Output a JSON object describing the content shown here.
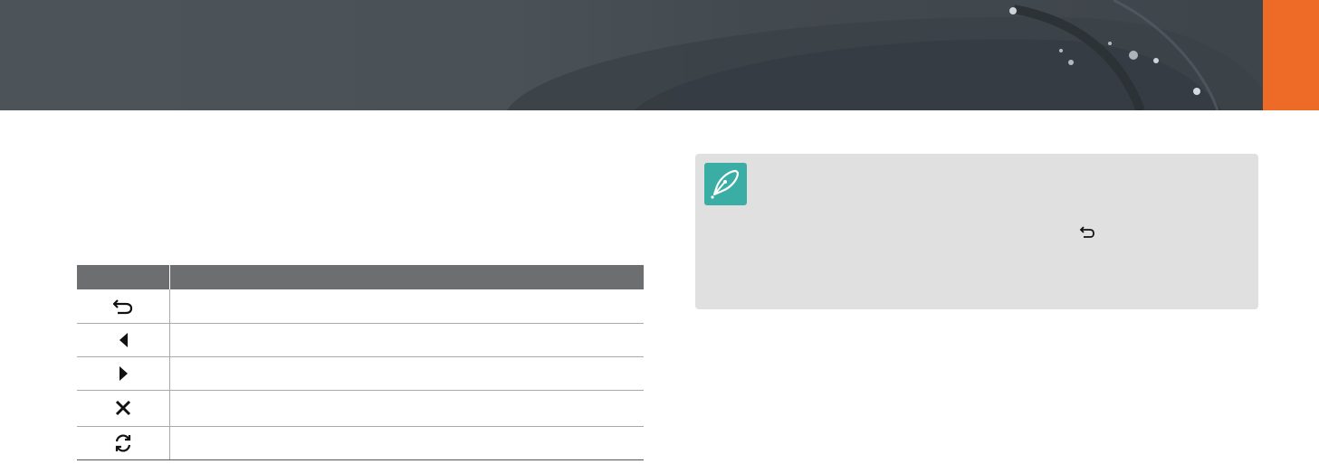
{
  "header": {
    "accent_color": "#ee6a27",
    "banner_color": "#4a5258"
  },
  "table": {
    "headers": [
      "",
      ""
    ],
    "rows": [
      {
        "icon": "return-icon",
        "text": ""
      },
      {
        "icon": "triangle-left-icon",
        "text": ""
      },
      {
        "icon": "triangle-right-icon",
        "text": ""
      },
      {
        "icon": "close-x-icon",
        "text": ""
      },
      {
        "icon": "refresh-icon",
        "text": ""
      }
    ]
  },
  "note": {
    "icon": "pen-note-icon",
    "icon_color": "#3aada4",
    "inline_icon": "return-icon",
    "text": ""
  }
}
